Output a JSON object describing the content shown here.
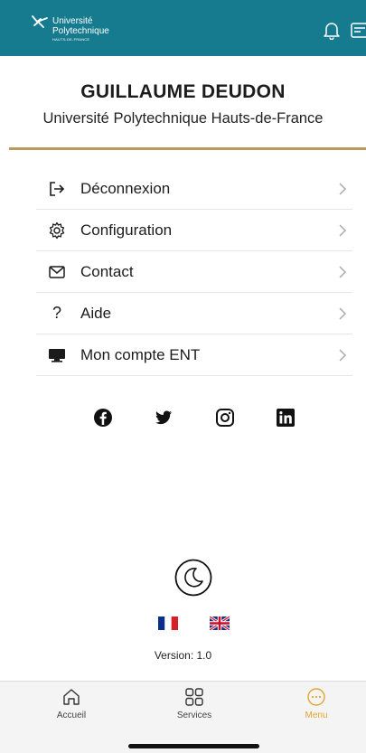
{
  "header": {
    "logo_line1": "Université",
    "logo_line2": "Polytechnique",
    "logo_line3": "HAUTS-DE-FRANCE",
    "bg_color": "#167b8e",
    "icons": [
      "bell-icon",
      "card-icon"
    ]
  },
  "profile": {
    "name": "GUILLAUME DEUDON",
    "institution": "Université Polytechnique Hauts-de-France"
  },
  "menu": {
    "items": [
      {
        "label": "Déconnexion",
        "icon": "logout-icon"
      },
      {
        "label": "Configuration",
        "icon": "gear-icon"
      },
      {
        "label": "Contact",
        "icon": "envelope-icon"
      },
      {
        "label": "Aide",
        "icon": "question-icon"
      },
      {
        "label": "Mon compte ENT",
        "icon": "monitor-icon"
      }
    ]
  },
  "socials": [
    "facebook-icon",
    "twitter-icon",
    "instagram-icon",
    "linkedin-icon"
  ],
  "theme_toggle": "moon-icon",
  "languages": [
    "fr-flag",
    "uk-flag"
  ],
  "version": "Version: 1.0",
  "tabbar": {
    "tabs": [
      {
        "label": "Accueil",
        "icon": "home-icon",
        "active": false
      },
      {
        "label": "Services",
        "icon": "grid-icon",
        "active": false
      },
      {
        "label": "Menu",
        "icon": "more-icon",
        "active": true
      }
    ],
    "active_color": "#e3a531"
  }
}
